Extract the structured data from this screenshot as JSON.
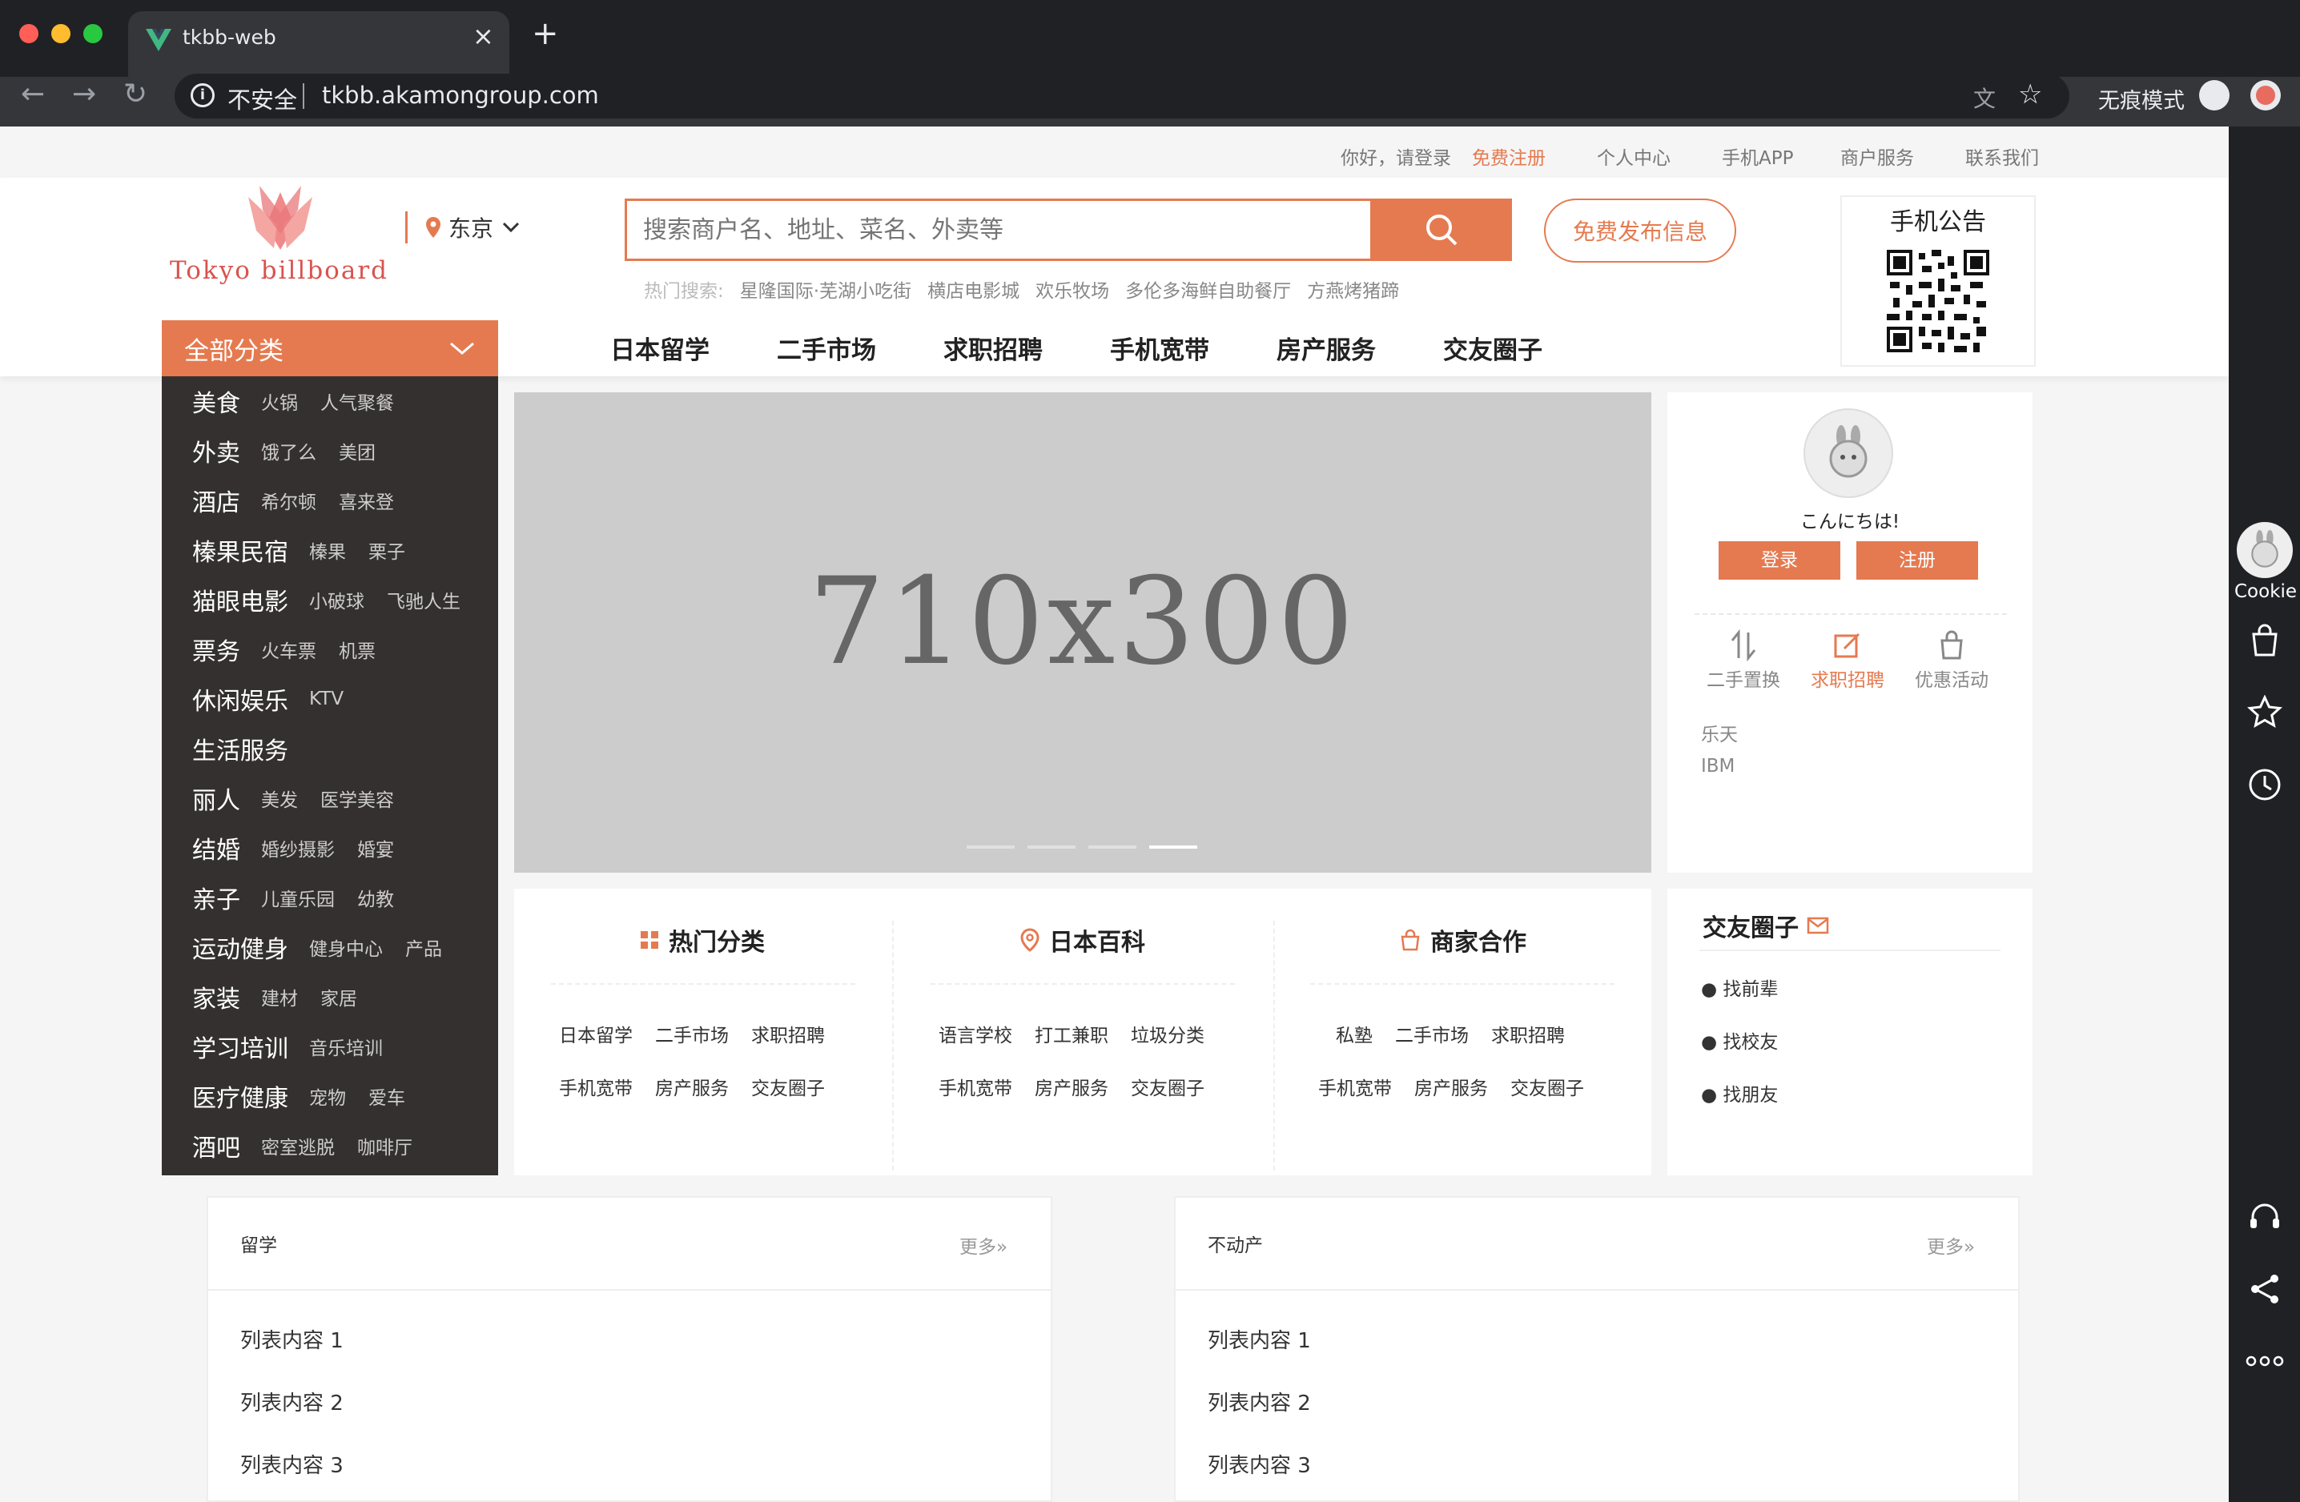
{
  "browser": {
    "tab_title": "tkbb-web",
    "security": "不安全",
    "url": "tkbb.akamongroup.com",
    "incognito_label": "无痕模式"
  },
  "topbar": {
    "greeting": "你好，请登录",
    "register": "免费注册",
    "personal": "个人中心",
    "app": "手机APP",
    "merchant": "商户服务",
    "contact": "联系我们"
  },
  "logo": {
    "text": "Tokyo billboard"
  },
  "location": {
    "city": "东京"
  },
  "search": {
    "placeholder": "搜索商户名、地址、菜名、外卖等",
    "hot_label": "热门搜索:",
    "hot": [
      "星隆国际·芜湖小吃街",
      "横店电影城",
      "欢乐牧场",
      "多伦多海鲜自助餐厅",
      "方燕烤猪蹄"
    ]
  },
  "publish_button": "免费发布信息",
  "notice": {
    "title": "手机公告"
  },
  "category_header": "全部分类",
  "nav": [
    "日本留学",
    "二手市场",
    "求职招聘",
    "手机宽带",
    "房产服务",
    "交友圈子"
  ],
  "categories": [
    {
      "main": "美食",
      "subs": [
        "火锅",
        "人气聚餐"
      ]
    },
    {
      "main": "外卖",
      "subs": [
        "饿了么",
        "美团"
      ]
    },
    {
      "main": "酒店",
      "subs": [
        "希尔顿",
        "喜来登"
      ]
    },
    {
      "main": "榛果民宿",
      "subs": [
        "榛果",
        "栗子"
      ]
    },
    {
      "main": "猫眼电影",
      "subs": [
        "小破球",
        "飞驰人生"
      ]
    },
    {
      "main": "票务",
      "subs": [
        "火车票",
        "机票"
      ]
    },
    {
      "main": "休闲娱乐",
      "subs": [
        "KTV"
      ]
    },
    {
      "main": "生活服务",
      "subs": []
    },
    {
      "main": "丽人",
      "subs": [
        "美发",
        "医学美容"
      ]
    },
    {
      "main": "结婚",
      "subs": [
        "婚纱摄影",
        "婚宴"
      ]
    },
    {
      "main": "亲子",
      "subs": [
        "儿童乐园",
        "幼教"
      ]
    },
    {
      "main": "运动健身",
      "subs": [
        "健身中心",
        "产品"
      ]
    },
    {
      "main": "家装",
      "subs": [
        "建材",
        "家居"
      ]
    },
    {
      "main": "学习培训",
      "subs": [
        "音乐培训"
      ]
    },
    {
      "main": "医疗健康",
      "subs": [
        "宠物",
        "爱车"
      ]
    },
    {
      "main": "酒吧",
      "subs": [
        "密室逃脱",
        "咖啡厅"
      ]
    }
  ],
  "banner": {
    "text": "710x300"
  },
  "user_card": {
    "greeting": "こんにちは!",
    "login": "登录",
    "register": "注册",
    "shortcuts": [
      "二手置换",
      "求职招聘",
      "优惠活动"
    ],
    "links": [
      "乐天",
      "IBM"
    ]
  },
  "sections": [
    {
      "title": "热门分类",
      "links": [
        "日本留学",
        "二手市场",
        "求职招聘",
        "手机宽带",
        "房产服务",
        "交友圈子"
      ]
    },
    {
      "title": "日本百科",
      "links": [
        "语言学校",
        "打工兼职",
        "垃圾分类",
        "手机宽带",
        "房产服务",
        "交友圈子"
      ]
    },
    {
      "title": "商家合作",
      "links": [
        "私塾",
        "二手市场",
        "求职招聘",
        "手机宽带",
        "房产服务",
        "交友圈子"
      ]
    }
  ],
  "friends": {
    "title": "交友圈子",
    "items": [
      "● 找前辈",
      "● 找校友",
      "● 找朋友"
    ]
  },
  "lists": [
    {
      "title": "留学",
      "more": "更多",
      "items": [
        "列表内容 1",
        "列表内容 2",
        "列表内容 3"
      ]
    },
    {
      "title": "不动产",
      "more": "更多",
      "items": [
        "列表内容 1",
        "列表内容 2",
        "列表内容 3"
      ]
    }
  ],
  "sidebar": {
    "cookie": "Cookie"
  },
  "colors": {
    "accent": "#e57a50",
    "dark": "#34302f",
    "chrome": "#202124"
  }
}
